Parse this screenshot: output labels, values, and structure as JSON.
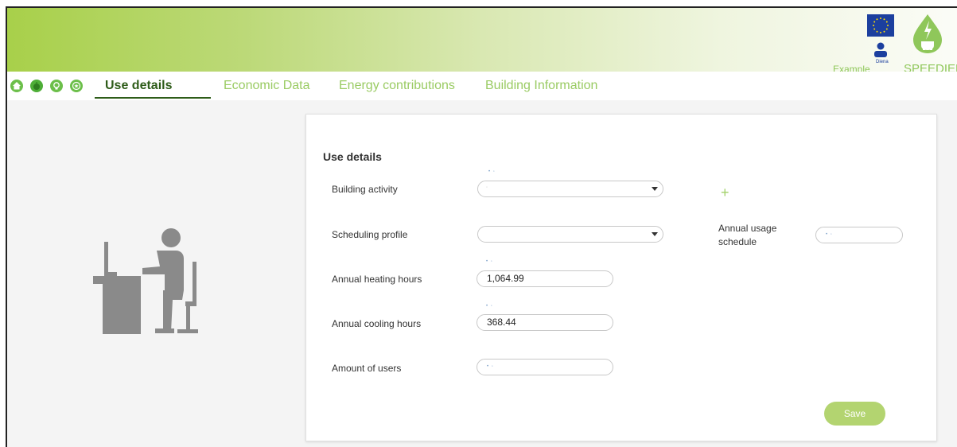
{
  "header": {
    "example_label": "Example",
    "user_name": "Diena",
    "logo_text": "SPEEDIER",
    "accent_color": "#a8d04a"
  },
  "nav": {
    "icons": [
      "home-icon",
      "apple-icon",
      "lightbulb-icon",
      "star-icon"
    ],
    "tabs": [
      "Use details",
      "Economic Data",
      "Energy contributions",
      "Building Information"
    ],
    "active_tab": "Use details"
  },
  "form": {
    "title": "Use details",
    "building_activity": {
      "label": "Building activity",
      "value": ""
    },
    "scheduling_profile": {
      "label": "Scheduling profile",
      "value": ""
    },
    "annual_usage_schedule": {
      "label": "Annual usage schedule",
      "value": ""
    },
    "annual_heating_hours": {
      "label": "Annual heating hours",
      "value": "1,064.99"
    },
    "annual_cooling_hours": {
      "label": "Annual cooling hours",
      "value": "368.44"
    },
    "amount_of_users": {
      "label": "Amount of users",
      "value": ""
    },
    "save_label": "Save"
  }
}
